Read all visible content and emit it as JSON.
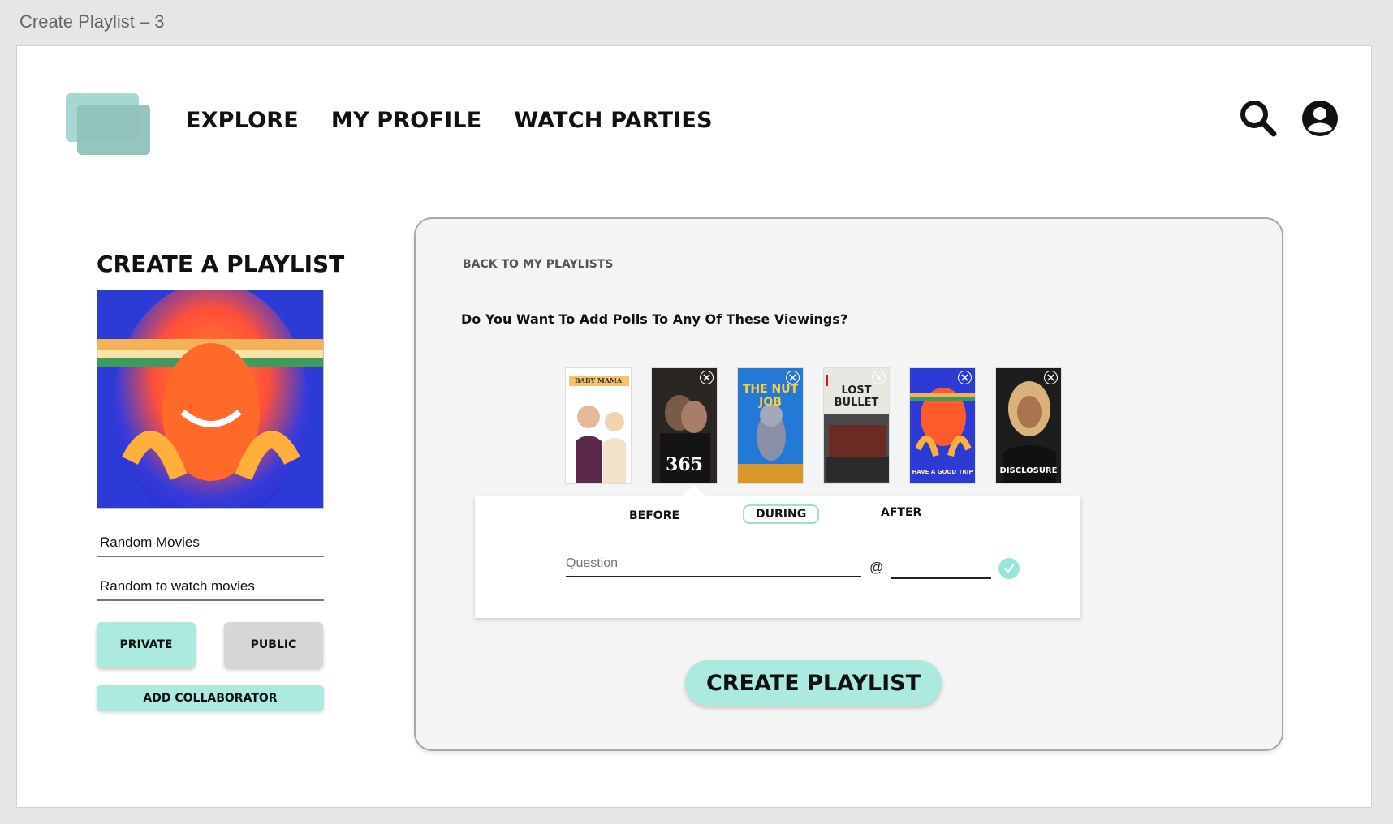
{
  "frame": {
    "title": "Create Playlist – 3"
  },
  "nav": {
    "items": [
      "EXPLORE",
      "MY PROFILE",
      "WATCH PARTIES"
    ]
  },
  "header": {
    "icons": [
      "search-icon",
      "account-icon"
    ]
  },
  "sidebar": {
    "title": "CREATE A PLAYLIST",
    "name_value": "Random Movies",
    "description_value": "Random to watch movies",
    "private_label": "PRIVATE",
    "public_label": "PUBLIC",
    "collaborator_label": "ADD COLLABORATOR"
  },
  "panel": {
    "back_label": "BACK TO MY PLAYLISTS",
    "prompt": "Do You Want To Add Polls To Any Of These Viewings?",
    "posters": [
      {
        "label": "BABY MAMA"
      },
      {
        "label": "365"
      },
      {
        "label": "THE NUT JOB"
      },
      {
        "label": "LOST BULLET"
      },
      {
        "label": "HAVE A GOOD TRIP"
      },
      {
        "label": "DISCLOSURE"
      }
    ],
    "poll": {
      "tabs": [
        "BEFORE",
        "DURING",
        "AFTER"
      ],
      "active_tab": "DURING",
      "question_placeholder": "Question",
      "at_symbol": "@"
    },
    "create_label": "CREATE PLAYLIST"
  },
  "colors": {
    "accent": "#ace9df",
    "panel_bg": "#f4f4f4",
    "logo": "#a5d8d2"
  }
}
